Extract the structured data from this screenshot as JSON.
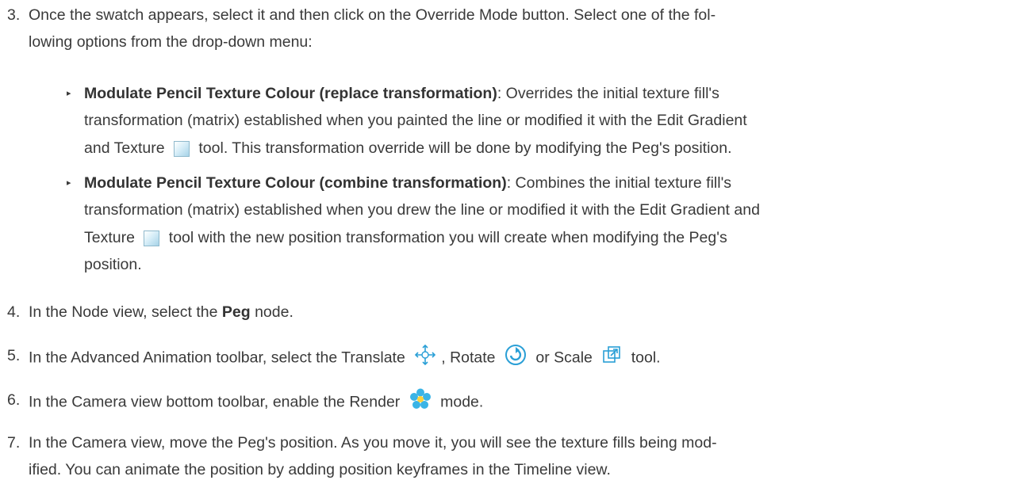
{
  "steps": [
    {
      "num": "3.",
      "l1": "Once the swatch appears, select it and then click on the Override Mode button. Select one of the fol-",
      "l2": "lowing options from the drop-down menu:"
    },
    {
      "num": "4.",
      "pre": "In the Node view, select the ",
      "bold": "Peg",
      "post": " node."
    },
    {
      "num": "5.",
      "pre": "In the Advanced Animation toolbar, select the Translate ",
      "mid1": ", Rotate ",
      "mid2": " or Scale ",
      "post": " tool."
    },
    {
      "num": "6.",
      "pre": "In the Camera view bottom toolbar, enable the Render ",
      "post": " mode."
    },
    {
      "num": "7.",
      "l1": "In the Camera view, move the Peg's position. As you move it, you will see the texture fills being mod-",
      "l2": "ified. You can animate the position by adding position keyframes in the Timeline view."
    }
  ],
  "options": [
    {
      "bullet": "▸",
      "bold": "Modulate Pencil Texture Colour (replace transformation)",
      "l1": ": Overrides the initial texture fill's",
      "l2": "transformation (matrix) established when you painted the line or modified it with the Edit Gradient",
      "l3a": "and Texture ",
      "l3b": " tool. This transformation override will be done by modifying the Peg's position."
    },
    {
      "bullet": "▸",
      "bold": "Modulate Pencil Texture Colour (combine transformation)",
      "l1": ": Combines the initial texture fill's",
      "l2": "transformation (matrix) established when you drew the line or modified it with the Edit Gradient and",
      "l3a": "Texture ",
      "l3b": " tool with the new position transformation you will create when modifying the Peg's",
      "l4": "position."
    }
  ],
  "icons": [
    "texture-swatch-icon",
    "translate-icon",
    "rotate-icon",
    "scale-icon",
    "render-flower-icon"
  ],
  "colors": {
    "text": "#3a3a3a",
    "swatch": "#a7d3e8",
    "icon_blue": "#2a9fd6"
  }
}
